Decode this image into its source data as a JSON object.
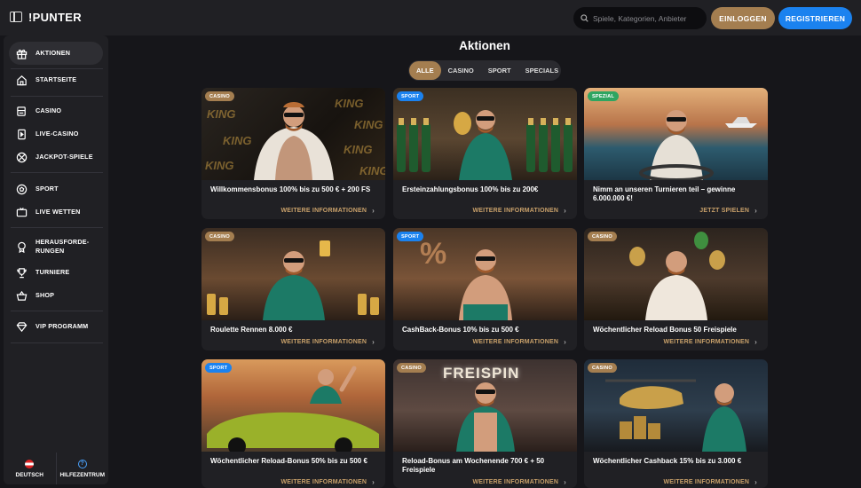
{
  "header": {
    "logo": "PUNTER",
    "logo_prefix": "!",
    "search_placeholder": "Spiele, Kategorien, Anbieter",
    "login_label": "EINLOGGEN",
    "register_label": "REGISTRIEREN"
  },
  "sidebar": {
    "items": [
      {
        "label": "AKTIONEN",
        "icon": "gift-icon",
        "active": true
      },
      {
        "label": "STARTSEITE",
        "icon": "home-icon"
      },
      {
        "label": "CASINO",
        "icon": "casino-cards-icon"
      },
      {
        "label": "LIVE-CASINO",
        "icon": "live-casino-icon"
      },
      {
        "label": "JACKPOT-SPIELE",
        "icon": "jackpot-icon"
      },
      {
        "label": "SPORT",
        "icon": "football-icon"
      },
      {
        "label": "LIVE WETTEN",
        "icon": "live-tv-icon"
      },
      {
        "label": "HERAUSFORDE-\nRUNGEN",
        "label_line1": "HERAUSFORDE-",
        "label_line2": "RUNGEN",
        "icon": "trophy-challenge-icon"
      },
      {
        "label": "TURNIERE",
        "icon": "trophy-icon"
      },
      {
        "label": "SHOP",
        "icon": "basket-icon"
      },
      {
        "label": "VIP PROGRAMM",
        "icon": "diamond-icon"
      }
    ],
    "language_label": "DEUTSCH",
    "help_label": "HILFEZENTRUM"
  },
  "main": {
    "title": "Aktionen",
    "tabs": [
      "ALLE",
      "CASINO",
      "SPORT",
      "SPECIALS"
    ],
    "active_tab": "ALLE",
    "cards": [
      {
        "badge": "CASINO",
        "title": "Willkommensbonus 100% bis zu 500 € + 200 FS",
        "link": "WEITERE INFORMATIONEN"
      },
      {
        "badge": "SPORT",
        "title": "Ersteinzahlungsbonus 100% bis zu 200€",
        "link": "WEITERE INFORMATIONEN"
      },
      {
        "badge": "SPEZIAL",
        "title": "Nimm an unseren Turnieren teil – gewinne 6.000.000 €!",
        "link": "JETZT SPIELEN"
      },
      {
        "badge": "CASINO",
        "title": "Roulette Rennen 8.000 €",
        "link": "WEITERE INFORMATIONEN"
      },
      {
        "badge": "SPORT",
        "title": "CashBack-Bonus 10% bis zu 500 €",
        "link": "WEITERE INFORMATIONEN"
      },
      {
        "badge": "CASINO",
        "title": "Wöchentlicher Reload Bonus 50 Freispiele",
        "link": "WEITERE INFORMATIONEN"
      },
      {
        "badge": "SPORT",
        "title": "Wöchentlicher Reload-Bonus 50% bis zu 500 €",
        "link": "WEITERE INFORMATIONEN"
      },
      {
        "badge": "CASINO",
        "title": "Reload-Bonus am Wochenende 700 € + 50 Freispiele",
        "link": "WEITERE INFORMATIONEN"
      },
      {
        "badge": "CASINO",
        "title": "Wöchentlicher Cashback 15% bis zu 3.000 €",
        "link": "WEITERE INFORMATIONEN"
      }
    ],
    "image_text": {
      "king": "KING",
      "freespin": "FREISPIN"
    }
  },
  "colors": {
    "bg": "#16161a",
    "panel": "#202024",
    "gold": "#a47e50",
    "blue": "#1b82ef",
    "green": "#2fa561",
    "link_gold": "#c8a06a"
  }
}
